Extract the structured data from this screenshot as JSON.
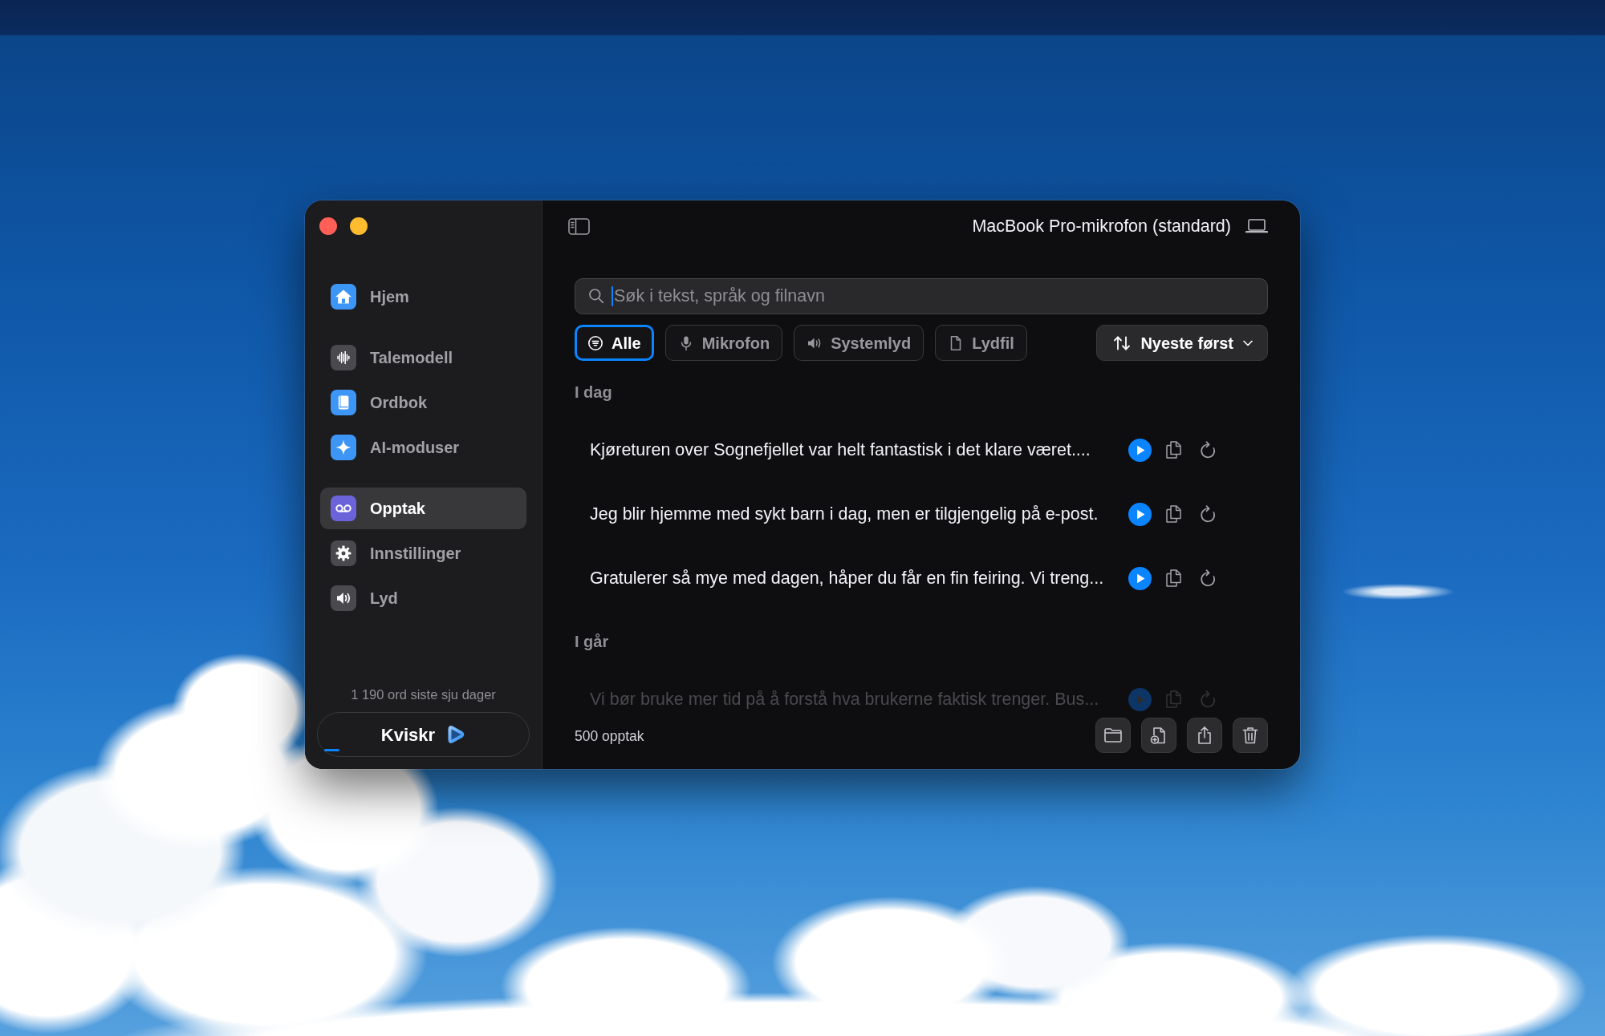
{
  "header": {
    "device": "MacBook Pro-mikrofon (standard)"
  },
  "sidebar": {
    "sections": [
      {
        "items": [
          {
            "kind": "home",
            "label": "Hjem",
            "color": "#3d95f5",
            "selected": false
          }
        ]
      },
      {
        "items": [
          {
            "kind": "waveform",
            "label": "Talemodell",
            "color": "#4a4a4e",
            "selected": false
          },
          {
            "kind": "book",
            "label": "Ordbok",
            "color": "#3d95f5",
            "selected": false
          },
          {
            "kind": "sparkle",
            "label": "AI-moduser",
            "color": "#3d95f5",
            "selected": false
          }
        ]
      },
      {
        "items": [
          {
            "kind": "recording",
            "label": "Opptak",
            "color": "#6b63d9",
            "selected": true
          },
          {
            "kind": "gear",
            "label": "Innstillinger",
            "color": "#4a4a4e",
            "selected": false
          },
          {
            "kind": "speaker",
            "label": "Lyd",
            "color": "#4a4a4e",
            "selected": false
          }
        ]
      }
    ],
    "stats": "1 190 ord siste sju dager",
    "app_button": "Kviskr"
  },
  "search": {
    "placeholder": "Søk i tekst, språk og filnavn",
    "focused": true
  },
  "filters": [
    {
      "kind": "all",
      "label": "Alle",
      "selected": true
    },
    {
      "kind": "microphone",
      "label": "Mikrofon",
      "selected": false
    },
    {
      "kind": "speaker",
      "label": "Systemlyd",
      "selected": false
    },
    {
      "kind": "file",
      "label": "Lydfil",
      "selected": false
    }
  ],
  "sort": {
    "label": "Nyeste først"
  },
  "groups": [
    {
      "title": "I dag",
      "rows": [
        {
          "text": "Kjøreturen over Sognefjellet var helt fantastisk i det klare været....",
          "faded": false
        },
        {
          "text": "Jeg blir hjemme med sykt barn i dag, men er tilgjengelig på e-post.",
          "faded": false
        },
        {
          "text": "Gratulerer så mye med dagen, håper du får en fin feiring. Vi treng...",
          "faded": false
        }
      ]
    },
    {
      "title": "I går",
      "rows": [
        {
          "text": "Vi bør bruke mer tid på å forstå hva brukerne faktisk trenger. Bus...",
          "faded": true
        }
      ]
    }
  ],
  "footer": {
    "count": "500 opptak"
  }
}
